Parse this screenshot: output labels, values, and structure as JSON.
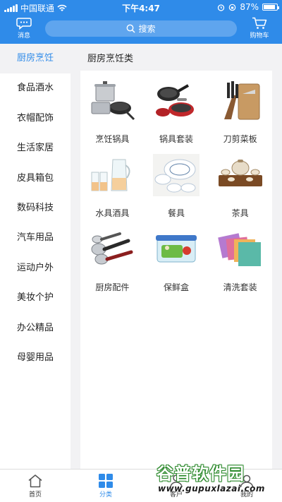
{
  "status_bar": {
    "carrier": "中国联通",
    "time": "下午4:47",
    "battery": "87%"
  },
  "header": {
    "message_label": "消息",
    "search_placeholder": "搜索",
    "cart_label": "购物车"
  },
  "sidebar": {
    "items": [
      {
        "label": "厨房烹饪",
        "active": true
      },
      {
        "label": "食品酒水"
      },
      {
        "label": "衣帽配饰"
      },
      {
        "label": "生活家居"
      },
      {
        "label": "皮具箱包"
      },
      {
        "label": "数码科技"
      },
      {
        "label": "汽车用品"
      },
      {
        "label": "运动户外"
      },
      {
        "label": "美妆个护"
      },
      {
        "label": "办公精品"
      },
      {
        "label": "母婴用品"
      }
    ]
  },
  "content": {
    "title": "厨房烹饪类",
    "products": [
      {
        "label": "烹饪锅具",
        "icon": "cookware-set-image"
      },
      {
        "label": "锅具套装",
        "icon": "pan-set-image"
      },
      {
        "label": "刀剪菜板",
        "icon": "knife-board-image"
      },
      {
        "label": "水具酒具",
        "icon": "glassware-image"
      },
      {
        "label": "餐具",
        "icon": "tableware-image"
      },
      {
        "label": "茶具",
        "icon": "tea-set-image"
      },
      {
        "label": "厨房配件",
        "icon": "kitchen-tools-image"
      },
      {
        "label": "保鲜盒",
        "icon": "food-container-image"
      },
      {
        "label": "清洗套装",
        "icon": "cleaning-cloth-image"
      }
    ]
  },
  "tabbar": {
    "tabs": [
      {
        "label": "首页"
      },
      {
        "label": "分类",
        "active": true
      },
      {
        "label": "客户"
      },
      {
        "label": "我的"
      }
    ]
  },
  "watermark": {
    "title": "谷普软件园",
    "url": "www.gupuxlazai.com"
  },
  "colors": {
    "accent": "#2f8be9",
    "background": "#f2f2f4"
  }
}
